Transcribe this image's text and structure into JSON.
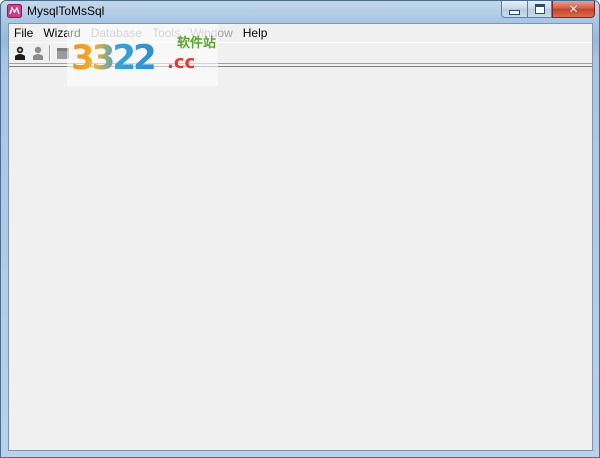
{
  "window": {
    "title": "MysqlToMsSql",
    "close_glyph": "✕"
  },
  "menubar": {
    "items": [
      {
        "label": "File",
        "enabled": true
      },
      {
        "label": "Wizard",
        "enabled": true
      },
      {
        "label": "Database",
        "enabled": false
      },
      {
        "label": "Tools",
        "enabled": false
      },
      {
        "label": "Window",
        "enabled": false
      },
      {
        "label": "Help",
        "enabled": true
      }
    ]
  },
  "toolbar": {
    "buttons": [
      {
        "icon": "user-connect-icon",
        "enabled": true
      },
      {
        "icon": "user-disconnect-icon",
        "enabled": false
      },
      {
        "icon": "database-icon",
        "enabled": false
      }
    ]
  },
  "watermark": {
    "number": "3322",
    "domain_suffix": ".cc",
    "tagline": "软件站"
  },
  "colors": {
    "title_bar": "#a9c6e4",
    "client_bg": "#f0f0f0",
    "close_button": "#c2412a",
    "disabled_text": "#a0a0a0"
  }
}
